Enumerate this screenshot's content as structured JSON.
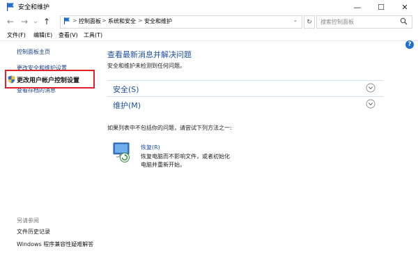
{
  "window": {
    "title": "安全和维护",
    "minimize_glyph": "—",
    "maximize_glyph": "☐",
    "close_glyph": "✕"
  },
  "nav": {
    "back_glyph": "←",
    "forward_glyph": "→",
    "history_glyph": "⌄",
    "up_glyph": "↑",
    "breadcrumbs": [
      "控制面板",
      "系统和安全",
      "安全和维护"
    ],
    "separator": ">",
    "dropdown_glyph": "⌄",
    "refresh_glyph": "↻",
    "search_placeholder": "搜索控制面板"
  },
  "menu": [
    "文件(F)",
    "编辑(E)",
    "查看(V)",
    "工具(T)"
  ],
  "sidebar": {
    "home": "控制面板主页",
    "change_settings": "更改安全和维护设置",
    "uac_settings": "更改用户帐户控制设置",
    "archived_messages": "查看存档的消息",
    "see_also": "另请参阅",
    "file_history": "文件历史记录",
    "compat": "Windows 程序兼容性疑难解答"
  },
  "main": {
    "title": "查看最新消息并解决问题",
    "subtitle": "安全和维护未检测到任何问题。",
    "sections": [
      {
        "label": "安全(S)"
      },
      {
        "label": "维护(M)"
      }
    ],
    "suggest": "如果列表中不包括你的问题，请尝试下列方法之一:",
    "recovery_link": "恢复(R)",
    "recovery_desc": "恢复电脑而不影响文件，或者初始化电脑并重新开始。"
  },
  "colors": {
    "link": "#1e4fa0",
    "highlight_border": "#e0202a"
  }
}
